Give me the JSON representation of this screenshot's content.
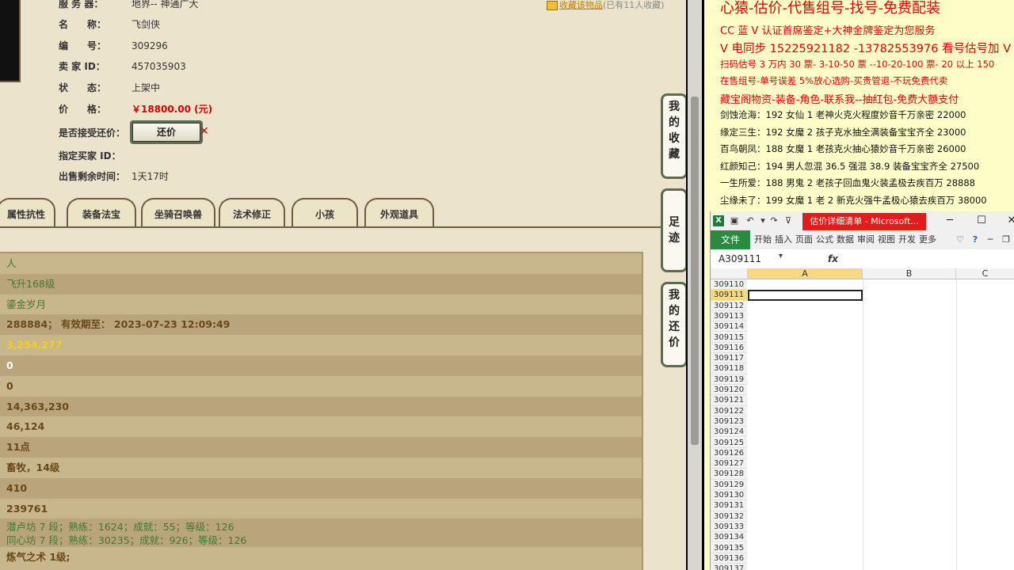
{
  "item_info": {
    "server_label": "服 务 器：",
    "server_value": "地界-- 神通广大",
    "name_label": "名　　称：",
    "name_value": "飞剑侠",
    "number_label": "编　　号：",
    "number_value": "309296",
    "seller_label": "卖 家 ID：",
    "seller_value": "457035903",
    "status_label": "状　　态：",
    "status_value": "上架中",
    "price_label": "价　　格：",
    "price_value": "￥18800.00 (元)",
    "counter_label": "是否接受还价：",
    "counter_button": "还价",
    "buyer_label": "指定买家 ID：",
    "buyer_value": "",
    "time_label": "出售剩余时间：",
    "time_value": "1天17时"
  },
  "favorite": {
    "link": "收藏该物品",
    "count": "(已有11人收藏)"
  },
  "tabs": [
    "属性抗性",
    "装备法宝",
    "坐骑召唤兽",
    "法术修正",
    "小孩",
    "外观道具"
  ],
  "side_buttons": [
    [
      "我",
      "的",
      "收",
      "藏"
    ],
    [
      "足",
      "迹"
    ],
    [
      "我",
      "的",
      "还",
      "价"
    ]
  ],
  "content_rows": [
    {
      "text": "人",
      "color": "green"
    },
    {
      "text": "飞升168级",
      "color": "green"
    },
    {
      "text": "鎏金岁月",
      "color": "green"
    },
    {
      "text": "288884； 有效期至： 2023-07-23 12:09:49",
      "color": "brown"
    },
    {
      "text": "3,254,277",
      "color": "yellow"
    },
    {
      "text": "0",
      "color": "white"
    },
    {
      "text": "0",
      "color": "brown"
    },
    {
      "text": "14,363,230",
      "color": "brown"
    },
    {
      "text": "46,124",
      "color": "brown"
    },
    {
      "text": "11点",
      "color": "brown"
    },
    {
      "text": "畜牧，14级",
      "color": "brown"
    },
    {
      "text": "410",
      "color": "brown"
    },
    {
      "text": "239761",
      "color": "brown"
    }
  ],
  "content_double": [
    "潜卢坊 7 段；熟练：1624；成就：55；等级：126",
    "同心坊 7 段；熟练：30235；成就：926；等级：126"
  ],
  "content_last": "炼气之术 1级;",
  "promo_lines": [
    {
      "text": "心猿-估价-代售组号-找号-免费配装",
      "color": "red"
    },
    {
      "text": "CC 蓝 V 认证首席鉴定+大神金牌鉴定为您服务",
      "color": "red"
    },
    {
      "text": "V 电同步 15225921182 -13782553976 看号估号加 V",
      "color": "red"
    },
    {
      "text": "扫码估号 3 万内 30 票- 3-10-50 票 --10-20-100 票- 20 以上 150",
      "color": "red"
    },
    {
      "text": "在售组号-单号误差 5%放心选购-买贵管退-不玩免费代卖",
      "color": "red"
    },
    {
      "text": "藏宝阁物资-装备-角色-联系我--抽红包-免费大额支付",
      "color": "red"
    },
    {
      "text": "剑蚀沧海：192 女仙 1 老神火克火程度妙音千万亲密 22000",
      "color": "black"
    },
    {
      "text": "缘定三生：192 女魔 2 孩子克水抽全满装备宝宝齐全 23000",
      "color": "black"
    },
    {
      "text": "百鸟朝凤：188 女魔 1 老孩克火抽心猿妙音千万亲密 26000",
      "color": "black"
    },
    {
      "text": "红颜知己：194 男人忽混 36.5 强混 38.9 装备宝宝齐全 27500",
      "color": "black"
    },
    {
      "text": "一生所爱：188 男鬼 2 老孩子回血鬼火装孟极去疾百万 28888",
      "color": "black"
    },
    {
      "text": "尘缘未了：199 女魔 1 老 2 新克火强牛孟极心猿去疾百万 38000",
      "color": "black"
    }
  ],
  "excel": {
    "doc_title": "估价详细清单 - Microsoft...",
    "file_tab": "文件",
    "ribbon_tabs": [
      "开始",
      "插入",
      "页面",
      "公式",
      "数据",
      "审阅",
      "视图",
      "开发",
      "更多"
    ],
    "name_box": "A309111",
    "fx": "fx",
    "columns": [
      "A",
      "B",
      "C"
    ],
    "rows": [
      "309110",
      "309111",
      "309112",
      "309113",
      "309114",
      "309115",
      "309116",
      "309117",
      "309118",
      "309119",
      "309120",
      "309121",
      "309122",
      "309123",
      "309124",
      "309125",
      "309126",
      "309127",
      "309128",
      "309129",
      "309130",
      "309131",
      "309132",
      "309133",
      "309134",
      "309135",
      "309136",
      "309137"
    ],
    "selected_row": "309111"
  }
}
